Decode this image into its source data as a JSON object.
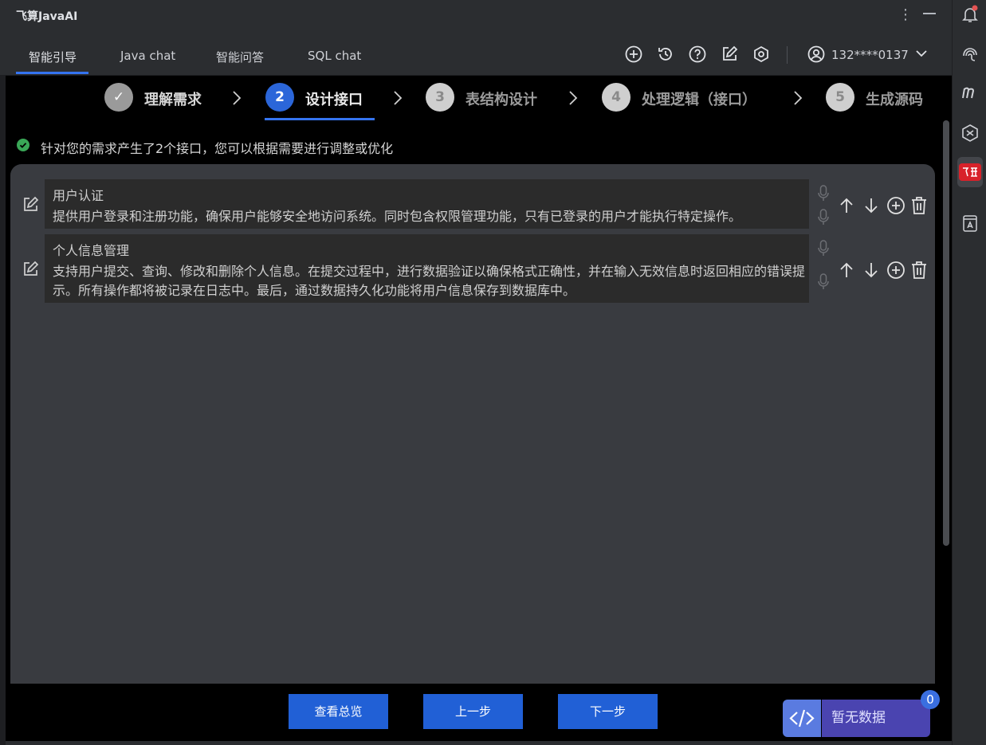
{
  "app": {
    "title": "飞算JavaAI"
  },
  "tabs": [
    {
      "label": "智能引导",
      "active": true
    },
    {
      "label": "Java chat",
      "active": false
    },
    {
      "label": "智能问答",
      "active": false
    },
    {
      "label": "SQL chat",
      "active": false
    }
  ],
  "toolbar": {
    "icons": [
      "add-circle-icon",
      "history-icon",
      "help-icon",
      "edit-icon",
      "settings-icon"
    ],
    "user": {
      "phone": "132****0137"
    }
  },
  "steps": [
    {
      "num": "✓",
      "label": "理解需求",
      "state": "done"
    },
    {
      "num": "2",
      "label": "设计接口",
      "state": "active"
    },
    {
      "num": "3",
      "label": "表结构设计",
      "state": "pending"
    },
    {
      "num": "4",
      "label": "处理逻辑（接口）",
      "state": "pending"
    },
    {
      "num": "5",
      "label": "生成源码",
      "state": "pending"
    }
  ],
  "notice": {
    "text": "针对您的需求产生了2个接口，您可以根据需要进行调整或优化"
  },
  "interfaces": [
    {
      "title": "用户认证",
      "desc": "提供用户登录和注册功能，确保用户能够安全地访问系统。同时包含权限管理功能，只有已登录的用户才能执行特定操作。"
    },
    {
      "title": "个人信息管理",
      "desc": "支持用户提交、查询、修改和删除个人信息。在提交过程中，进行数据验证以确保格式正确性，并在输入无效信息时返回相应的错误提示。所有操作都将被记录在日志中。最后，通过数据持久化功能将用户信息保存到数据库中。"
    }
  ],
  "buttons": {
    "overview": "查看总览",
    "prev": "上一步",
    "next": "下一步"
  },
  "widget": {
    "label": "暂无数据",
    "badge": "0"
  },
  "colors": {
    "accent": "#3574f0",
    "button": "#2160d6",
    "success": "#3aa757"
  }
}
